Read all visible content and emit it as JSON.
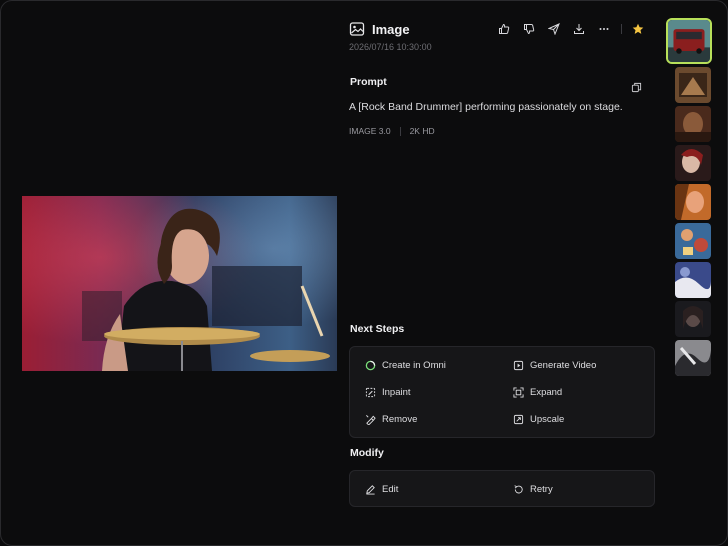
{
  "header": {
    "title": "Image",
    "timestamp": "2026/07/16 10:30:00",
    "actions": [
      "thumbs-up-icon",
      "thumbs-down-icon",
      "share-icon",
      "download-icon",
      "more-icon",
      "star-icon"
    ]
  },
  "prompt": {
    "heading": "Prompt",
    "text": "A [Rock Band Drummer] performing passionately on stage.",
    "model": "IMAGE 3.0",
    "resolution": "2K HD"
  },
  "next_steps": {
    "heading": "Next Steps",
    "items": [
      {
        "label": "Create in Omni",
        "icon": "omni-icon"
      },
      {
        "label": "Generate Video",
        "icon": "video-icon"
      },
      {
        "label": "Inpaint",
        "icon": "inpaint-icon"
      },
      {
        "label": "Expand",
        "icon": "expand-icon"
      },
      {
        "label": "Remove",
        "icon": "remove-icon"
      },
      {
        "label": "Upscale",
        "icon": "upscale-icon"
      }
    ]
  },
  "modify": {
    "heading": "Modify",
    "items": [
      {
        "label": "Edit",
        "icon": "pencil-icon"
      },
      {
        "label": "Retry",
        "icon": "retry-icon"
      }
    ]
  },
  "colors": {
    "accent_selected": "#b8e05a",
    "star": "#f5c542",
    "background": "#0c0c0d"
  }
}
